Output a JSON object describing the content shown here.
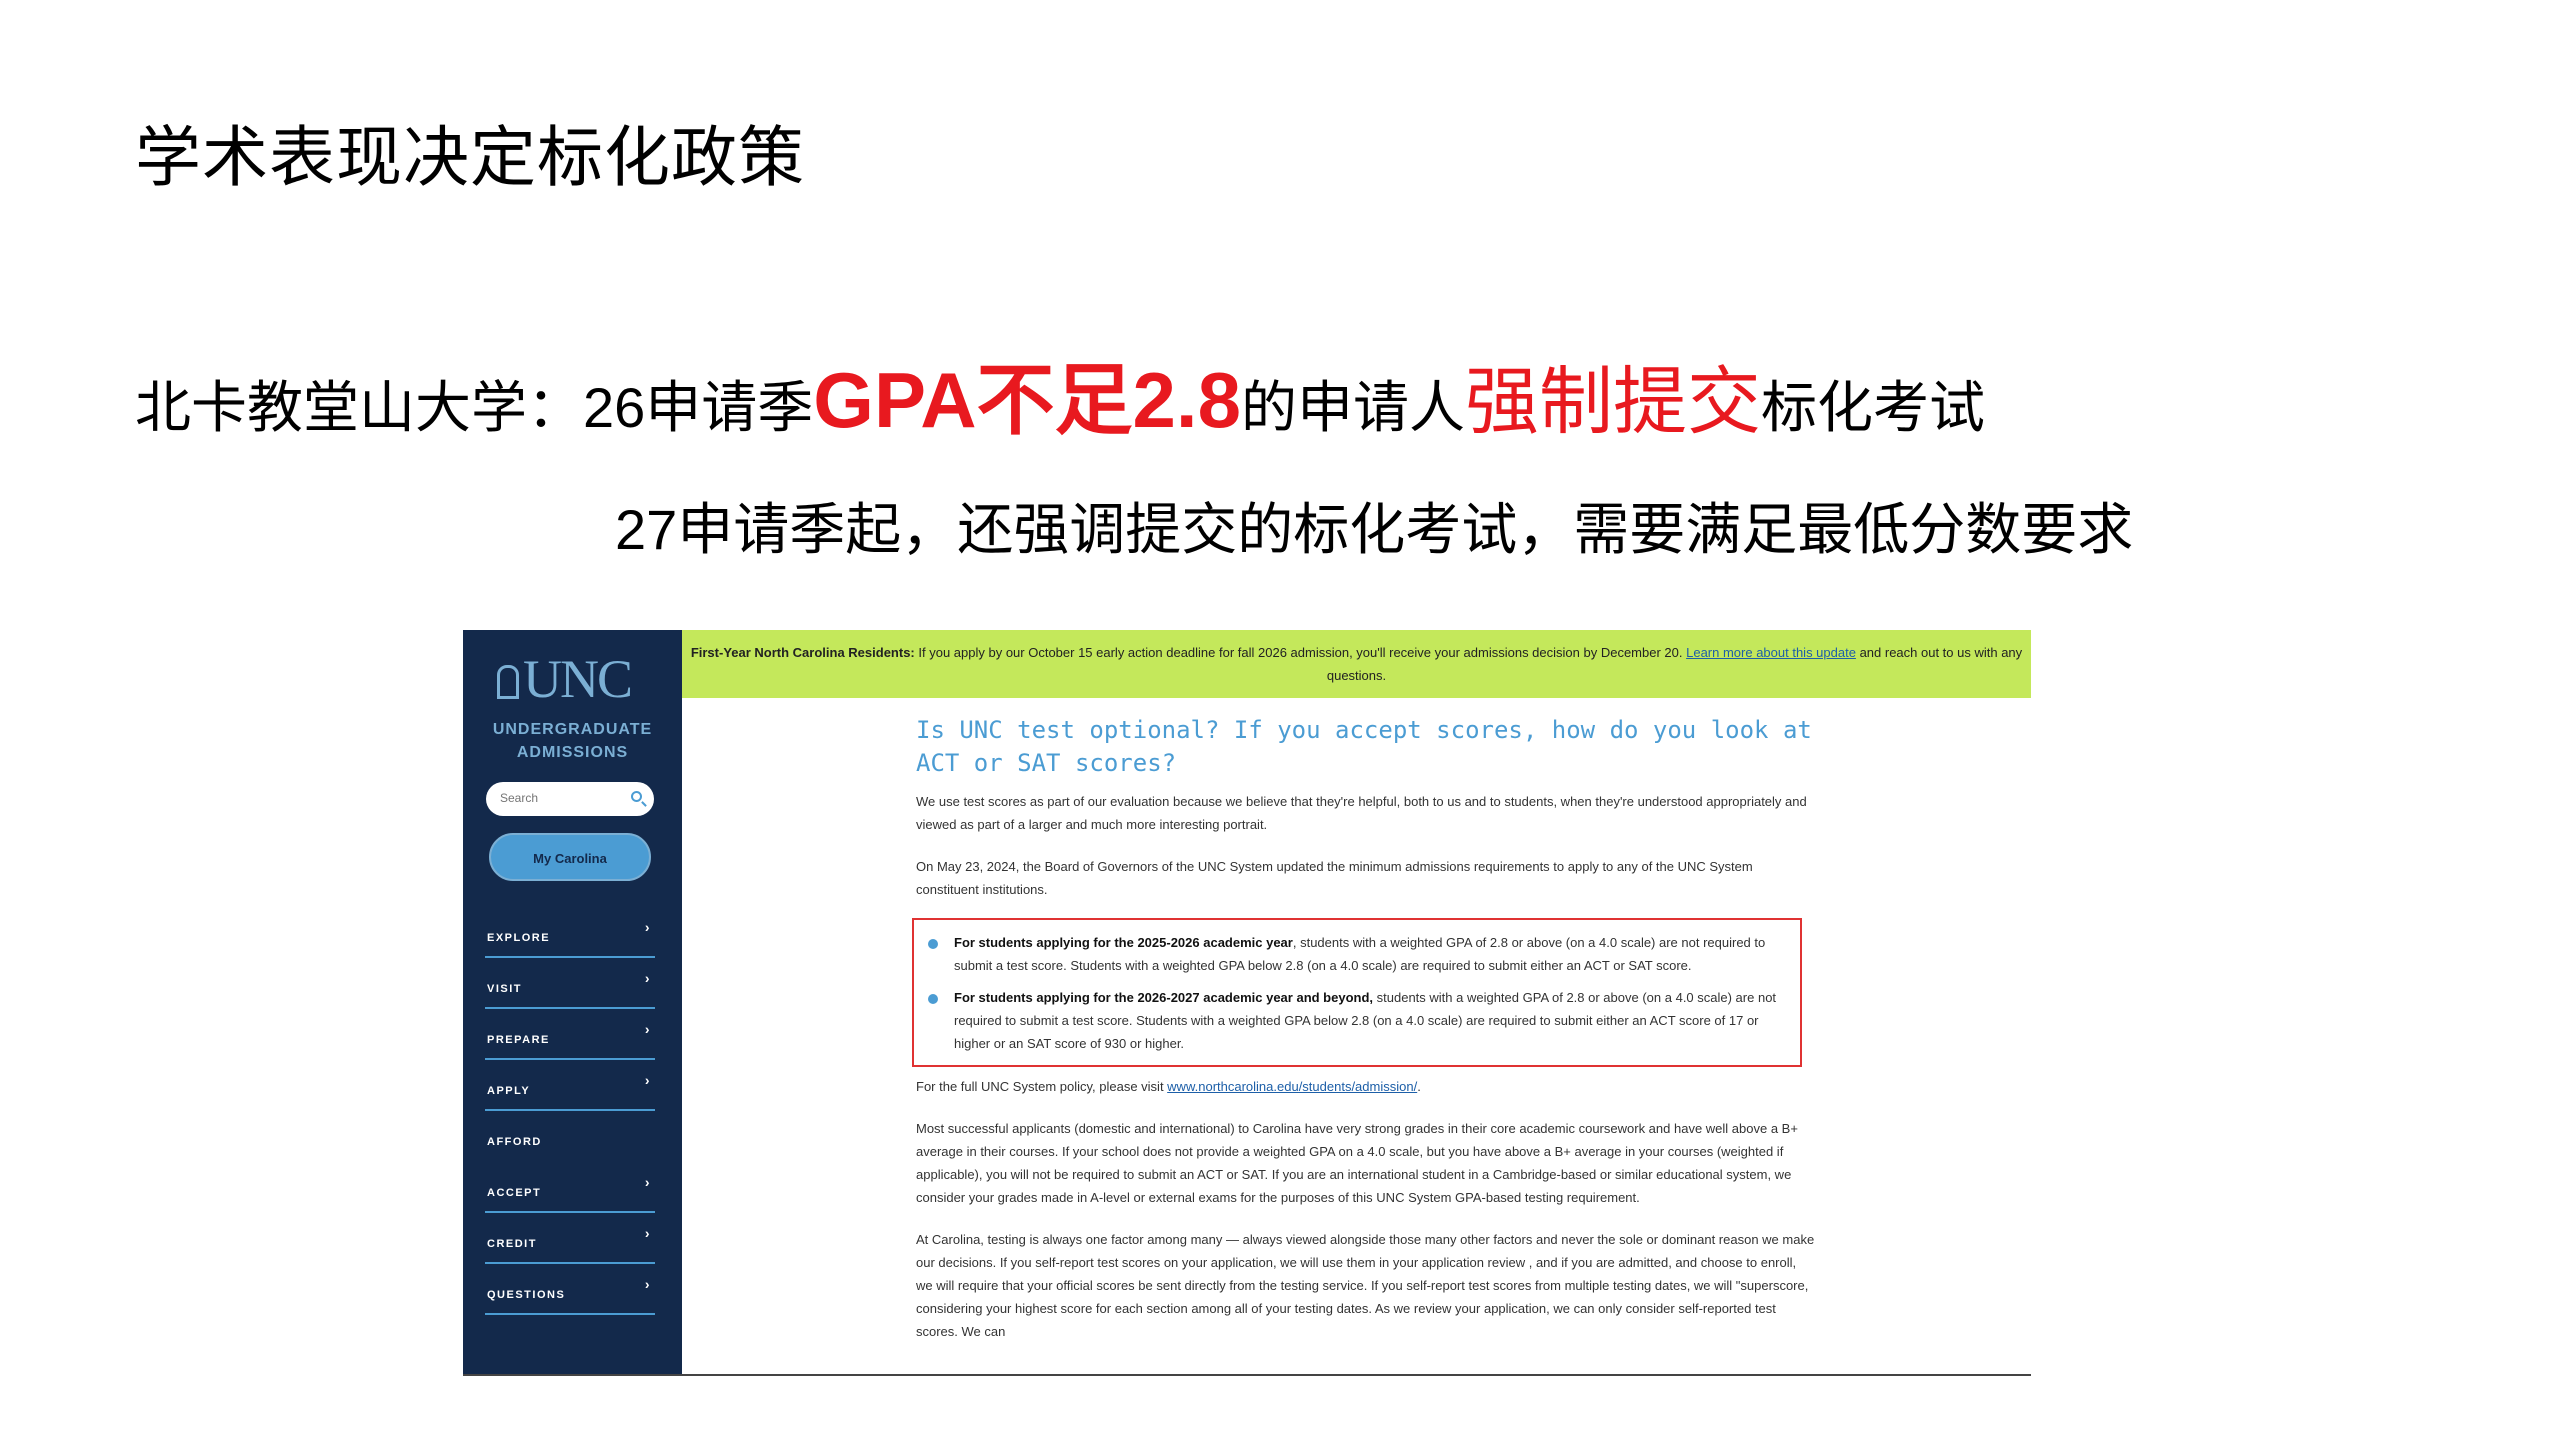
{
  "slide": {
    "title": "学术表现决定标化政策",
    "line1": {
      "prefix": "北卡教堂山大学：",
      "year": "26",
      "season": "申请季",
      "gpa": "GPA不足2.8",
      "mid": "的申请人",
      "mandatory": "强制提交",
      "suffix": "标化考试"
    },
    "line2": {
      "year": "27",
      "text": "申请季起，还强调提交的标化考试，需要满足最低分数要求"
    }
  },
  "screenshot": {
    "sidebar": {
      "logo": "UNC",
      "subtitle_line1": "UNDERGRADUATE",
      "subtitle_line2": "ADMISSIONS",
      "search_placeholder": "Search",
      "my_carolina": "My Carolina",
      "nav": [
        {
          "label": "EXPLORE",
          "chevron": true
        },
        {
          "label": "VISIT",
          "chevron": true
        },
        {
          "label": "PREPARE",
          "chevron": true
        },
        {
          "label": "APPLY",
          "chevron": true
        },
        {
          "label": "AFFORD",
          "chevron": false
        },
        {
          "label": "ACCEPT",
          "chevron": true
        },
        {
          "label": "CREDIT",
          "chevron": true
        },
        {
          "label": "QUESTIONS",
          "chevron": true
        }
      ]
    },
    "banner": {
      "bold": "First-Year North Carolina Residents:",
      "text": " If you apply by our October 15 early action deadline for fall 2026 admission, you'll receive your admissions decision by December 20. ",
      "link": "Learn more about this update",
      "tail": " and reach out to us with any questions."
    },
    "content": {
      "heading": "Is UNC test optional? If you accept scores, how do you look at ACT or SAT scores?",
      "p1": "We use test scores as part of our evaluation because we believe that they're helpful, both to us and to students, when they're understood appropriately and viewed as part of a larger and much more interesting portrait.",
      "p2": "On May 23, 2024, the Board of Governors of the UNC System updated the minimum admissions requirements to apply to any of the UNC System constituent institutions.",
      "bullet1_bold": "For students applying for the 2025-2026 academic year",
      "bullet1_text": ", students with a weighted GPA of 2.8 or above (on a 4.0 scale) are not required to submit a test score. Students with a weighted GPA below 2.8 (on a 4.0 scale) are required to submit either an ACT or SAT score.",
      "bullet2_bold": "For students applying for the 2026-2027 academic year and beyond,",
      "bullet2_text": " students with a weighted GPA of 2.8 or above (on a 4.0 scale) are not required to submit a test score. Students with a weighted GPA below 2.8 (on a 4.0 scale) are required to submit either an ACT score of 17 or higher or an SAT score of 930 or higher.",
      "policy_text": "For the full UNC System policy, please visit ",
      "policy_link": "www.northcarolina.edu/students/admission/",
      "policy_end": ".",
      "p3": "Most successful applicants (domestic and international) to Carolina have very strong grades in their core academic coursework and have well above a B+ average in their courses. If your school does not provide a weighted GPA on a 4.0 scale, but you have above a B+ average in your courses (weighted if applicable), you will not be required to submit an ACT or SAT. If you are an international student in a Cambridge-based or similar educational system, we consider your grades made in A-level or external exams for the purposes of this UNC System GPA-based testing requirement.",
      "p4": "At Carolina, testing is always one factor among many — always viewed alongside those many other factors and never the sole or dominant reason we make our decisions. If you self-report test scores on your application, we will use them in your application review , and if you are admitted, and choose to enroll, we will require that your official scores be sent directly from the testing service. If you self-report test scores from multiple testing dates, we will \"superscore, considering your highest score for each section among all of your testing dates. As we review your application, we can only consider self-reported test scores. We can"
    }
  }
}
